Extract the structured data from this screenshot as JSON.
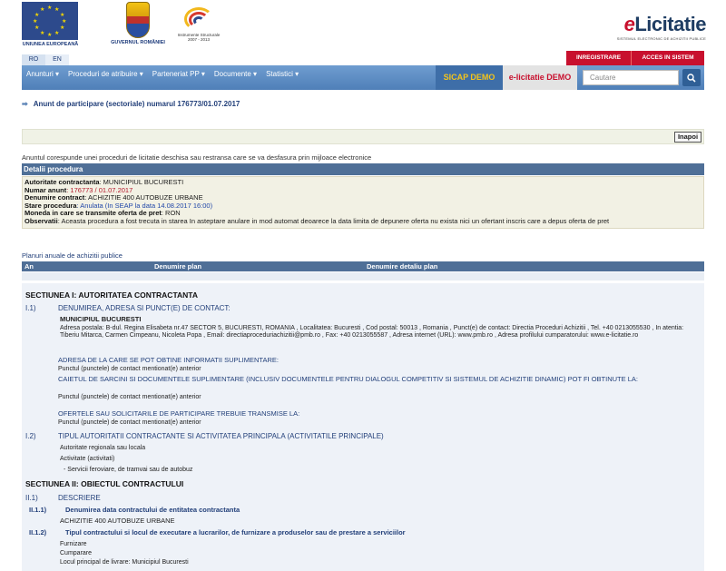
{
  "header": {
    "eu_caption": "UNIUNEA EUROPEANĂ",
    "gov_caption": "GUVERNUL ROMÂNIEI",
    "is_caption_1": "Instrumente Structurale",
    "is_caption_2": "2007 - 2013",
    "brand_e": "e",
    "brand": "Licitatie",
    "brand_sub": "SISTEMUL ELECTRONIC DE ACHIZITII PUBLICE",
    "lang_ro": "RO",
    "lang_en": "EN",
    "register": "INREGISTRARE",
    "login": "ACCES IN SISTEM"
  },
  "nav": {
    "items": [
      "Anunturi ▾",
      "Proceduri de atribuire ▾",
      "Parteneriat PP ▾",
      "Documente ▾",
      "Statistici ▾"
    ],
    "sicap": "SICAP DEMO",
    "elic_demo": "e-licitatie DEMO",
    "search_placeholder": "Cautare"
  },
  "page": {
    "title": "Anunt de participare (sectoriale) numarul 176773/01.07.2017",
    "back": "Inapoi",
    "intro": "Anuntul corespunde unei proceduri de licitatie deschisa sau restransa care se va desfasura prin mijloace electronice"
  },
  "detalii": {
    "heading": "Detalii procedura",
    "autoritate_lbl": "Autoritate contractanta",
    "autoritate_val": ": MUNICIPIUL BUCURESTI",
    "numar_lbl": "Numar anunt",
    "numar_val": ": 176773 / 01.07.2017",
    "denumire_lbl": "Denumire contract",
    "denumire_val": ": ACHIZITIE 400 AUTOBUZE URBANE",
    "stare_lbl": "Stare procedura",
    "stare_val": ": Anulata (In SEAP la data 14.08.2017 16:00)",
    "moneda_lbl": "Moneda in care se transmite oferta de pret",
    "moneda_val": ": RON",
    "obs_lbl": "Observatii",
    "obs_val": ": Aceasta procedura a fost trecuta in starea In asteptare anulare in mod automat deoarece la data limita de depunere oferta nu exista nici un ofertant inscris care a depus oferta de pret"
  },
  "planuri": {
    "label": "Planuri anuale de achizitii publice",
    "col_an": "An",
    "col_plan": "Denumire plan",
    "col_detaliu": "Denumire detaliu plan"
  },
  "sectiunea1": {
    "title": "SECTIUNEA I: AUTORITATEA CONTRACTANTA",
    "i1_num": "I.1)",
    "i1_lbl": "DENUMIREA, ADRESA SI PUNCT(E) DE CONTACT:",
    "org": "MUNICIPIUL BUCURESTI",
    "addr": "Adresa postala:  B-dul. Regina Elisabeta nr.47 SECTOR 5, BUCURESTI, ROMANIA , Localitatea:  Bucuresti , Cod postal:  50013 , Romania , Punct(e) de contact:  Directia Proceduri Achizitii , Tel.  +40 0213055530 , In atentia:  Tiberiu Mitarca, Carmen Cimpeanu, Nicoleta Popa , Email:  directiaproceduriachizitii@pmb.ro , Fax:  +40 0213055587 , Adresa internet (URL):  www.pmb.ro , Adresa profilului cumparatorului:  www.e-licitatie.ro",
    "addr_info_lbl": "ADRESA DE LA CARE SE POT OBTINE INFORMATII SUPLIMENTARE:",
    "addr_info_val": "Punctul (punctele) de contact mentionat(e) anterior",
    "caiet_lbl": "CAIETUL DE SARCINI SI DOCUMENTELE SUPLIMENTARE (INCLUSIV DOCUMENTELE PENTRU DIALOGUL COMPETITIV SI SISTEMUL DE ACHIZITIE DINAMIC) POT FI OBTINUTE LA:",
    "caiet_val": "Punctul (punctele) de contact mentionat(e) anterior",
    "oferte_lbl": "OFERTELE SAU SOLICITARILE DE PARTICIPARE TREBUIE TRANSMISE LA:",
    "oferte_val": "Punctul (punctele) de contact mentionat(e) anterior",
    "i2_num": "I.2)",
    "i2_lbl": "TIPUL AUTORITATII CONTRACTANTE SI ACTIVITATEA PRINCIPALA (ACTIVITATILE PRINCIPALE)",
    "i2_a": "Autoritate regionala sau locala",
    "i2_b": "Activitate (activitati)",
    "i2_c": "- Servicii feroviare, de tramvai sau de autobuz"
  },
  "sectiunea2": {
    "title": "SECTIUNEA II: OBIECTUL CONTRACTULUI",
    "ii1_num": "II.1)",
    "ii1_lbl": "DESCRIERE",
    "ii11_num": "II.1.1)",
    "ii11_lbl": "Denumirea data contractului de entitatea contractanta",
    "ii11_val": "ACHIZITIE 400 AUTOBUZE URBANE",
    "ii12_num": "II.1.2)",
    "ii12_lbl": "Tipul contractului si locul de executare a lucrarilor, de furnizare a produselor sau de prestare a serviciilor",
    "ii12_a": "Furnizare",
    "ii12_b": "Cumparare",
    "ii12_c": "Locul principal de livrare: Municipiul Bucuresti"
  },
  "colors": {
    "nav": "#4f7fb8",
    "panel": "#4f6f97",
    "brand_red": "#c8102e",
    "sicap_gold": "#f4c41a"
  }
}
